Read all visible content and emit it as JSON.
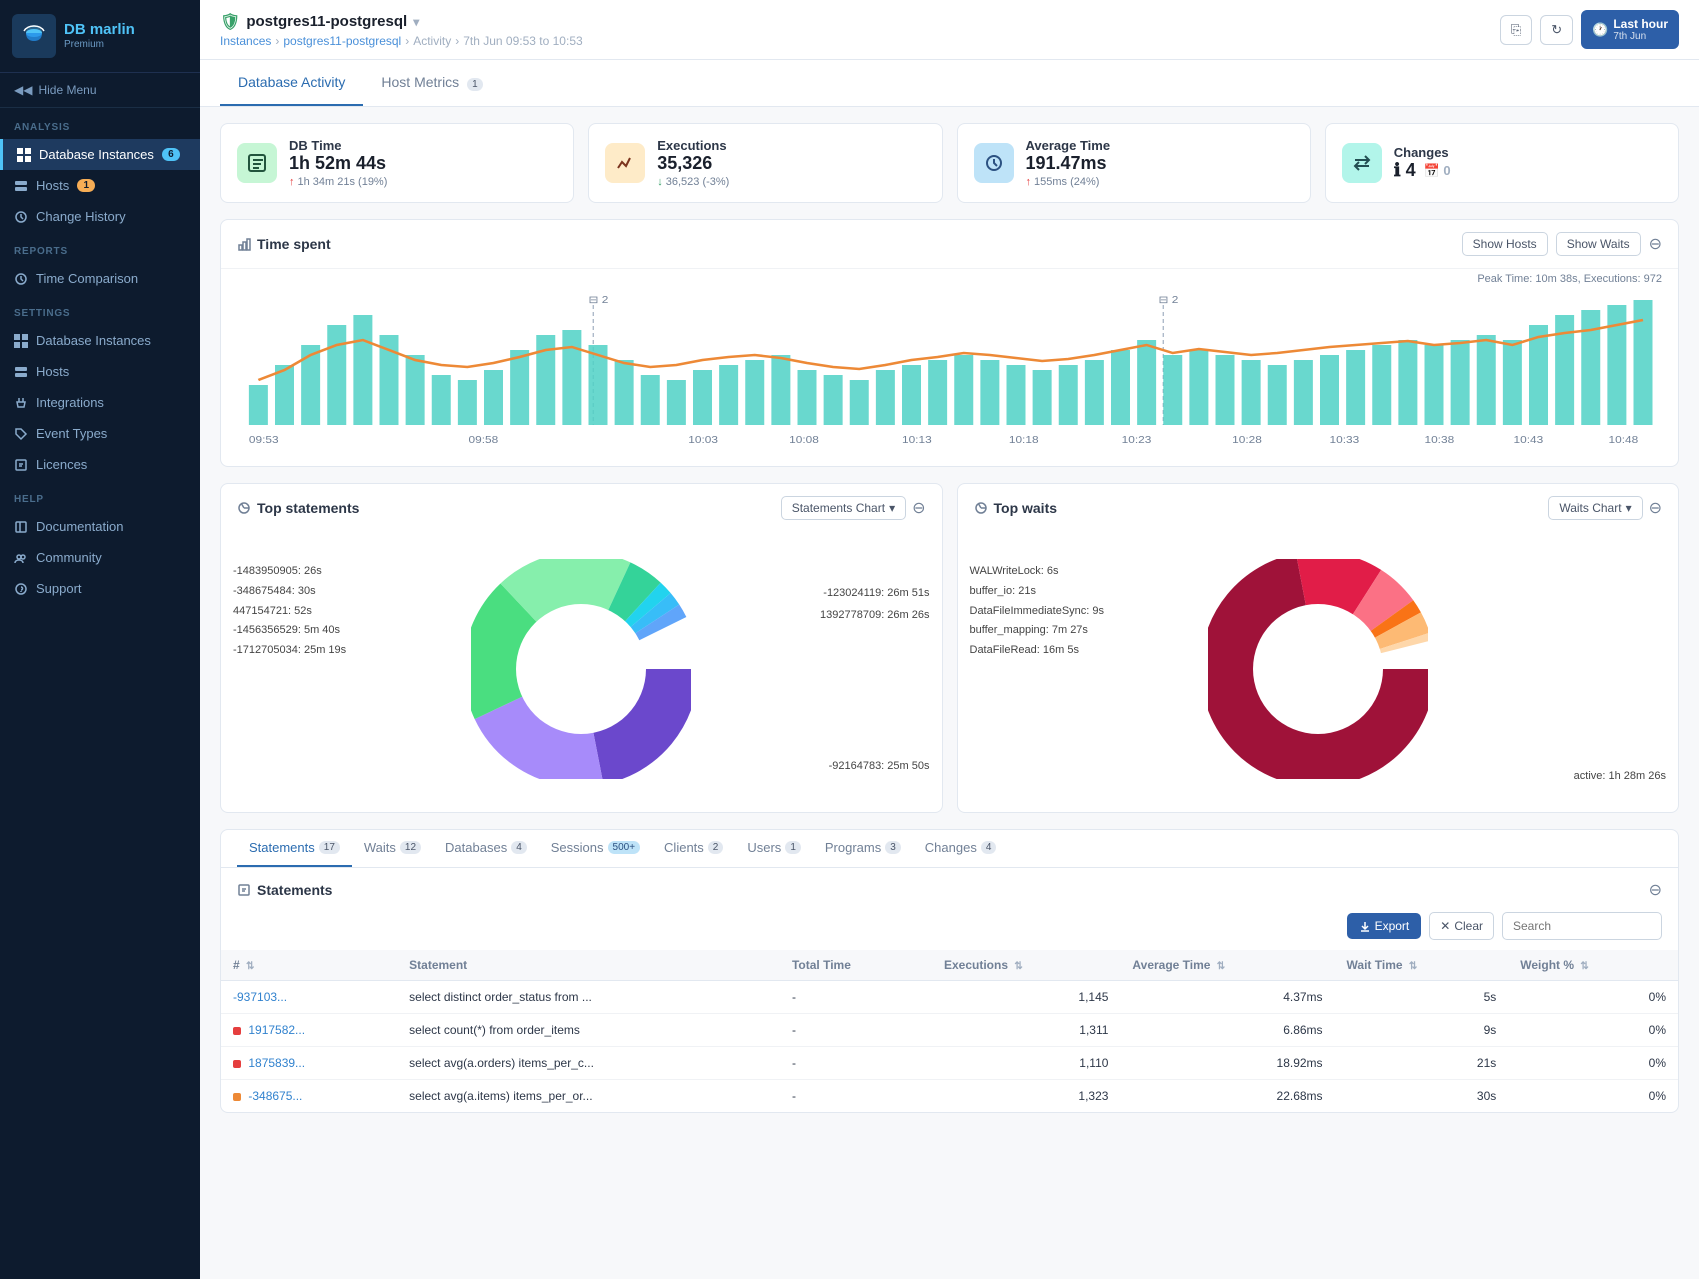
{
  "sidebar": {
    "logo_text": "DB marlin",
    "logo_sub": "Premium",
    "hide_menu_label": "Hide Menu",
    "sections": [
      {
        "label": "ANALYSIS",
        "items": [
          {
            "id": "database-instances",
            "label": "Database Instances",
            "badge": "6",
            "active": true,
            "icon": "grid"
          },
          {
            "id": "hosts",
            "label": "Hosts",
            "badge": "1",
            "active": false,
            "icon": "server"
          },
          {
            "id": "change-history",
            "label": "Change History",
            "badge": null,
            "active": false,
            "icon": "history"
          }
        ]
      },
      {
        "label": "REPORTS",
        "items": [
          {
            "id": "time-comparison",
            "label": "Time Comparison",
            "badge": null,
            "active": false,
            "icon": "clock"
          }
        ]
      },
      {
        "label": "SETTINGS",
        "items": [
          {
            "id": "db-instances-settings",
            "label": "Database Instances",
            "badge": null,
            "active": false,
            "icon": "grid"
          },
          {
            "id": "hosts-settings",
            "label": "Hosts",
            "badge": null,
            "active": false,
            "icon": "server"
          },
          {
            "id": "integrations",
            "label": "Integrations",
            "badge": null,
            "active": false,
            "icon": "plug"
          },
          {
            "id": "event-types",
            "label": "Event Types",
            "badge": null,
            "active": false,
            "icon": "tag"
          },
          {
            "id": "licences",
            "label": "Licences",
            "badge": null,
            "active": false,
            "icon": "license"
          }
        ]
      },
      {
        "label": "HELP",
        "items": [
          {
            "id": "documentation",
            "label": "Documentation",
            "badge": null,
            "active": false,
            "icon": "book"
          },
          {
            "id": "community",
            "label": "Community",
            "badge": null,
            "active": false,
            "icon": "people"
          },
          {
            "id": "support",
            "label": "Support",
            "badge": null,
            "active": false,
            "icon": "support"
          }
        ]
      }
    ]
  },
  "topbar": {
    "instance_name": "postgres11-postgresql",
    "breadcrumb": [
      "Instances",
      "postgres11-postgresql",
      "Activity"
    ],
    "time_range": "7th Jun 09:53 to 10:53",
    "last_hour_label": "Last hour",
    "last_hour_sub": "7th Jun"
  },
  "page_tabs": [
    {
      "label": "Database Activity",
      "active": true,
      "badge": null
    },
    {
      "label": "Host Metrics",
      "active": false,
      "badge": "1"
    }
  ],
  "metrics": [
    {
      "id": "db-time",
      "title": "DB Time",
      "value": "1h 52m 44s",
      "sub": "↑ 1h 34m 21s (19%)",
      "trend": "up",
      "icon_color": "green"
    },
    {
      "id": "executions",
      "title": "Executions",
      "value": "35,326",
      "sub": "↓ 36,523 (-3%)",
      "trend": "down",
      "icon_color": "orange"
    },
    {
      "id": "avg-time",
      "title": "Average Time",
      "value": "191.47ms",
      "sub": "↑ 155ms (24%)",
      "trend": "up",
      "icon_color": "blue"
    },
    {
      "id": "changes",
      "title": "Changes",
      "value": "4  0",
      "sub": "",
      "trend": "neutral",
      "icon_color": "teal"
    }
  ],
  "time_chart": {
    "title": "Time spent",
    "peak_label": "Peak Time: 10m 38s, Executions: 972",
    "show_hosts_label": "Show Hosts",
    "show_waits_label": "Show Waits",
    "x_labels": [
      "09:53",
      "09:58",
      "10:03",
      "10:08",
      "10:13",
      "10:18",
      "10:23",
      "10:28",
      "10:33",
      "10:38",
      "10:43",
      "10:48"
    ]
  },
  "top_statements": {
    "title": "Top statements",
    "chart_label": "Statements Chart",
    "segments": [
      {
        "label": "-123024119: 26m 51s",
        "color": "#6b48cc",
        "pct": 22
      },
      {
        "label": "1392778709: 26m 26s",
        "color": "#a78bfa",
        "pct": 21
      },
      {
        "label": "-92164783: 25m 50s",
        "color": "#4ade80",
        "pct": 20
      },
      {
        "label": "-1712705034: 25m 19s",
        "color": "#86efac",
        "pct": 19
      },
      {
        "label": "-1456356529: 5m 40s",
        "color": "#34d399",
        "pct": 5
      },
      {
        "label": "447154721: 52s",
        "color": "#22d3ee",
        "pct": 2
      },
      {
        "label": "-348675484: 30s",
        "color": "#38bdf8",
        "pct": 2
      },
      {
        "label": "-1483950905: 26s",
        "color": "#60a5fa",
        "pct": 2
      }
    ]
  },
  "top_waits": {
    "title": "Top waits",
    "chart_label": "Waits Chart",
    "segments": [
      {
        "label": "active: 1h 28m 26s",
        "color": "#9f1239",
        "pct": 72
      },
      {
        "label": "DataFileRead: 16m 5s",
        "color": "#e11d48",
        "pct": 12
      },
      {
        "label": "buffer_mapping: 7m 27s",
        "color": "#fb7185",
        "pct": 6
      },
      {
        "label": "DataFileImmediateSync: 9s",
        "color": "#f97316",
        "pct": 2
      },
      {
        "label": "buffer_io: 21s",
        "color": "#fdba74",
        "pct": 3
      },
      {
        "label": "WALWriteLock: 6s",
        "color": "#fed7aa",
        "pct": 1
      }
    ]
  },
  "bottom_tabs": [
    {
      "label": "Statements",
      "badge": "17",
      "active": true,
      "badge_type": "normal"
    },
    {
      "label": "Waits",
      "badge": "12",
      "active": false,
      "badge_type": "normal"
    },
    {
      "label": "Databases",
      "badge": "4",
      "active": false,
      "badge_type": "normal"
    },
    {
      "label": "Sessions",
      "badge": "500+",
      "active": false,
      "badge_type": "blue"
    },
    {
      "label": "Clients",
      "badge": "2",
      "active": false,
      "badge_type": "normal"
    },
    {
      "label": "Users",
      "badge": "1",
      "active": false,
      "badge_type": "normal"
    },
    {
      "label": "Programs",
      "badge": "3",
      "active": false,
      "badge_type": "normal"
    },
    {
      "label": "Changes",
      "badge": "4",
      "active": false,
      "badge_type": "normal"
    }
  ],
  "statements_section": {
    "title": "Statements",
    "export_label": "Export",
    "clear_label": "Clear",
    "search_placeholder": "Search",
    "columns": [
      "#",
      "Statement",
      "Total Time",
      "Executions",
      "Average Time",
      "Wait Time",
      "Weight %"
    ],
    "rows": [
      {
        "id": "-937103...",
        "statement": "select distinct order_status from ...",
        "total_time": "-",
        "executions": "1,145",
        "avg_time": "4.37ms",
        "wait_time": "5s",
        "weight": "0%",
        "color": null
      },
      {
        "id": "1917582...",
        "statement": "select count(*) from order_items",
        "total_time": "-",
        "executions": "1,311",
        "avg_time": "6.86ms",
        "wait_time": "9s",
        "weight": "0%",
        "color": "#e53e3e"
      },
      {
        "id": "1875839...",
        "statement": "select avg(a.orders) items_per_c...",
        "total_time": "-",
        "executions": "1,110",
        "avg_time": "18.92ms",
        "wait_time": "21s",
        "weight": "0%",
        "color": "#e53e3e"
      },
      {
        "id": "-348675...",
        "statement": "select avg(a.items) items_per_or...",
        "total_time": "-",
        "executions": "1,323",
        "avg_time": "22.68ms",
        "wait_time": "30s",
        "weight": "0%",
        "color": "#ed8936"
      }
    ]
  }
}
